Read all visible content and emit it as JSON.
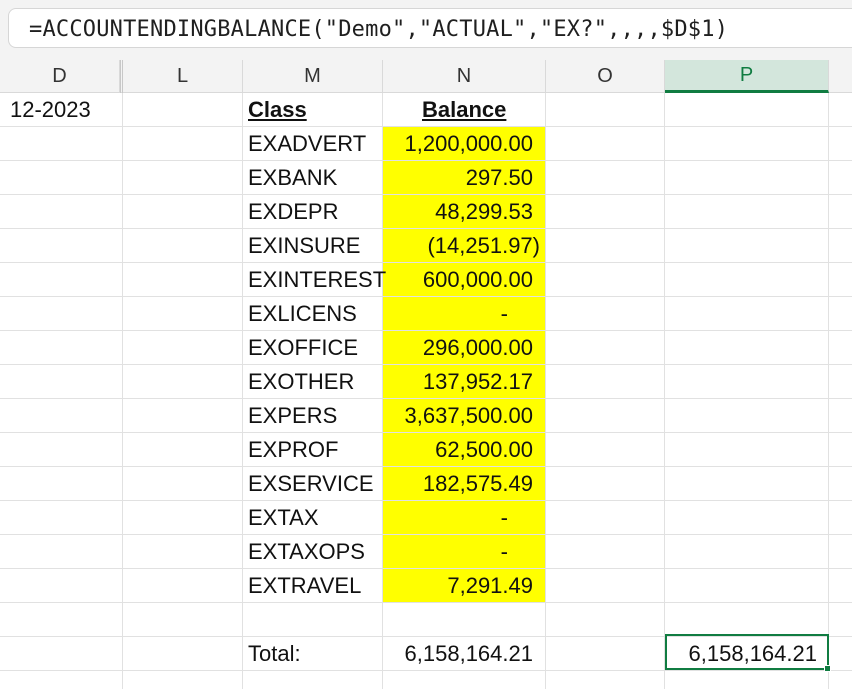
{
  "formula_bar": {
    "formula": "=ACCOUNTENDINGBALANCE(\"Demo\",\"ACTUAL\",\"EX?\",,,,$D$1)"
  },
  "columns": [
    "D",
    "L",
    "M",
    "N",
    "O",
    "P"
  ],
  "selected_column": "P",
  "cells": {
    "D1": "12-2023",
    "class_header": "Class",
    "balance_header": "Balance",
    "total_label": "Total:",
    "total_value": "6,158,164.21",
    "selected_value": "6,158,164.21"
  },
  "rows": [
    {
      "class": "EXADVERT",
      "balance": "1,200,000.00"
    },
    {
      "class": "EXBANK",
      "balance": "297.50"
    },
    {
      "class": "EXDEPR",
      "balance": "48,299.53"
    },
    {
      "class": "EXINSURE",
      "balance": "(14,251.97)"
    },
    {
      "class": "EXINTEREST",
      "balance": "600,000.00"
    },
    {
      "class": "EXLICENS",
      "balance": "-"
    },
    {
      "class": "EXOFFICE",
      "balance": "296,000.00"
    },
    {
      "class": "EXOTHER",
      "balance": "137,952.17"
    },
    {
      "class": "EXPERS",
      "balance": "3,637,500.00"
    },
    {
      "class": "EXPROF",
      "balance": "62,500.00"
    },
    {
      "class": "EXSERVICE",
      "balance": "182,575.49"
    },
    {
      "class": "EXTAX",
      "balance": "-"
    },
    {
      "class": "EXTAXOPS",
      "balance": "-"
    },
    {
      "class": "EXTRAVEL",
      "balance": "7,291.49"
    }
  ],
  "colors": {
    "highlight": "#ffff00",
    "selection": "#107c41",
    "selected_header_bg": "#d3e6dc"
  }
}
